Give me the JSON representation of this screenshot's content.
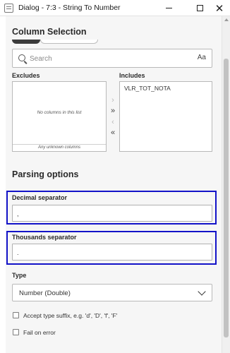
{
  "window": {
    "title": "Dialog - 7:3 - String To Number",
    "minimize_glyph": "",
    "maximize_glyph": "",
    "close_glyph": "✕"
  },
  "column_selection": {
    "heading": "Column Selection",
    "search": {
      "placeholder": "Search",
      "value": "",
      "case_toggle": "Aa"
    },
    "excludes": {
      "label": "Excludes",
      "empty_message": "No columns in this list",
      "footer": "Any unknown columns"
    },
    "includes": {
      "label": "Includes",
      "items": [
        "VLR_TOT_NOTA"
      ]
    },
    "move_buttons": {
      "right_one": "›",
      "right_all": "»",
      "left_one": "‹",
      "left_all": "«"
    }
  },
  "parsing_options": {
    "heading": "Parsing options",
    "decimal_separator": {
      "label": "Decimal separator",
      "value": ","
    },
    "thousands_separator": {
      "label": "Thousands separator",
      "value": "."
    },
    "type": {
      "label": "Type",
      "selected": "Number (Double)"
    },
    "accept_suffix": {
      "label": "Accept type suffix, e.g. 'd', 'D', 'f', 'F'",
      "checked": false
    },
    "fail_on_error": {
      "label": "Fail on error",
      "checked": false
    }
  },
  "colors": {
    "highlight": "#1313c8",
    "content_bg": "#f6f6f6"
  }
}
